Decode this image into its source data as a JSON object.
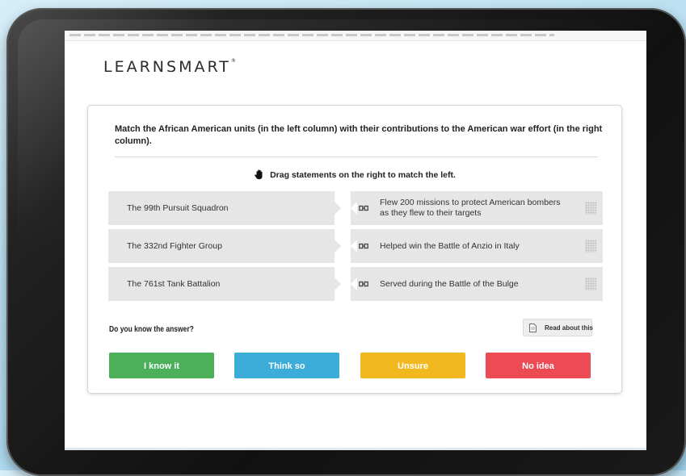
{
  "app": {
    "logo_text": "LEARNSMART",
    "logo_mark": "®"
  },
  "question": {
    "prompt": "Match the African American units (in the left column) with their contributions to the American war effort (in the right column).",
    "instruction": "Drag statements on the right to match the left."
  },
  "pairs": [
    {
      "left": "The 99th Pursuit Squadron",
      "right": "Flew 200 missions to protect American bombers as they flew to their targets"
    },
    {
      "left": "The 332nd Fighter Group",
      "right": "Helped win the Battle of Anzio in Italy"
    },
    {
      "left": "The 761st Tank Battalion",
      "right": "Served during the Battle of the Bulge"
    }
  ],
  "confidence": {
    "label": "Do you know the answer?",
    "read_about": "Read about this",
    "buttons": [
      {
        "label": "I know it",
        "color": "#4cb05b"
      },
      {
        "label": "Think so",
        "color": "#3cacd9"
      },
      {
        "label": "Unsure",
        "color": "#f2b81f"
      },
      {
        "label": "No idea",
        "color": "#ec4b54"
      }
    ]
  },
  "colors": {
    "cell_bg": "#e6e6e6",
    "tablet_frame": "#1a1a1a",
    "background": "#b9def0"
  },
  "icons": [
    "hand-icon",
    "link-icon",
    "drag-grip-icon",
    "document-icon"
  ]
}
